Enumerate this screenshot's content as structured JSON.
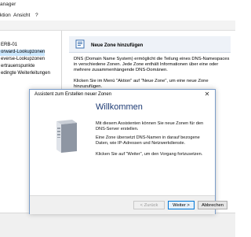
{
  "window": {
    "title": "anager"
  },
  "menu": [
    "ktion",
    "Ansicht",
    "?"
  ],
  "tree": {
    "items": [
      {
        "label": "ERB-01",
        "selected": false
      },
      {
        "label": "orward-Lookupzonen",
        "selected": true
      },
      {
        "label": "everse-Lookupzonen",
        "selected": false
      },
      {
        "label": "ertrauenspunkte",
        "selected": false
      },
      {
        "label": "edingte Weiterleitungen",
        "selected": false
      }
    ]
  },
  "details": {
    "title": "Neue Zone hinzufügen",
    "p1": "DNS (Domain Name System) ermöglicht die Teilung eines DNS-Namespaces in verschiedene Zonen. Jede Zone enthält Informationen über eine oder mehrere zusammenhängende DNS-Domänen.",
    "p2": "Klicken Sie im Menü \"Aktion\" auf \"Neue Zone\", um eine neue Zone hinzuzufügen."
  },
  "dialog": {
    "title": "Assistent zum Erstellen neuer Zonen",
    "close": "✕",
    "heading": "Willkommen",
    "p1": "Mit diesem Assistenten können Sie neue Zonen für den DNS-Server erstellen.",
    "p2": "Eine Zone übersetzt DNS-Namen in darauf bezogene Daten, wie IP-Adressen und Netzwerkdienste.",
    "p3": "Klicken Sie auf \"Weiter\", um den Vorgang fortzusetzen.",
    "buttons": {
      "back": "< Zurück",
      "next": "Weiter >",
      "cancel": "Abbrechen"
    }
  },
  "colors": {
    "accent": "#0078d7",
    "heading": "#1e3b74",
    "selection": "#cce8ff"
  }
}
